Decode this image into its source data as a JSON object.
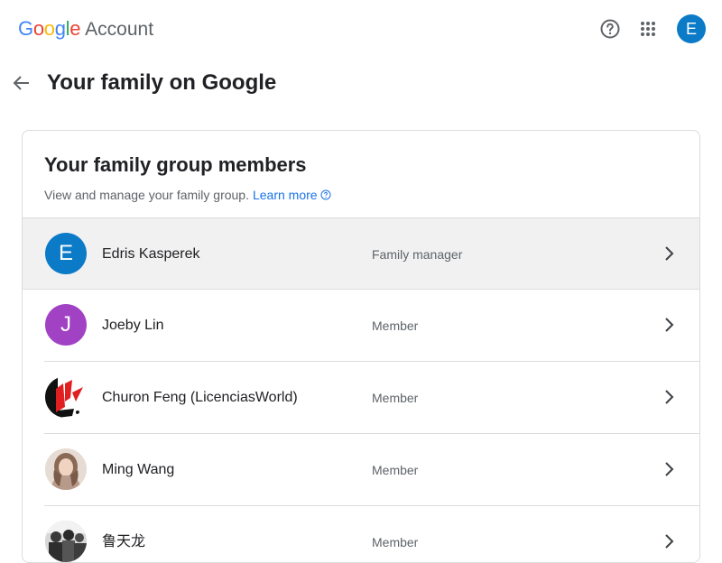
{
  "header": {
    "logo_letters": [
      "G",
      "o",
      "o",
      "g",
      "l",
      "e"
    ],
    "product": "Account",
    "avatar_letter": "E",
    "icons": [
      "help-circle-icon",
      "apps-grid-icon"
    ]
  },
  "page": {
    "title": "Your family on Google"
  },
  "card": {
    "title": "Your family group members",
    "description": "View and manage your family group.",
    "learn_more": "Learn more"
  },
  "members": [
    {
      "name": "Edris Kasperek",
      "role": "Family manager",
      "avatar_letter": "E",
      "avatar_color": "#0b7ac7"
    },
    {
      "name": "Joeby Lin",
      "role": "Member",
      "avatar_letter": "J",
      "avatar_color": "#a142c4"
    },
    {
      "name": "Churon Feng (LicenciasWorld)",
      "role": "Member",
      "avatar_letter": "",
      "avatar_color": "photo"
    },
    {
      "name": "Ming Wang",
      "role": "Member",
      "avatar_letter": "",
      "avatar_color": "photo"
    },
    {
      "name": "鲁天龙",
      "role": "Member",
      "avatar_letter": "",
      "avatar_color": "photo"
    }
  ],
  "colors": {
    "accent": "#1a73e8",
    "manager_row_bg": "#f1f1f1",
    "divider": "#dadce0"
  }
}
